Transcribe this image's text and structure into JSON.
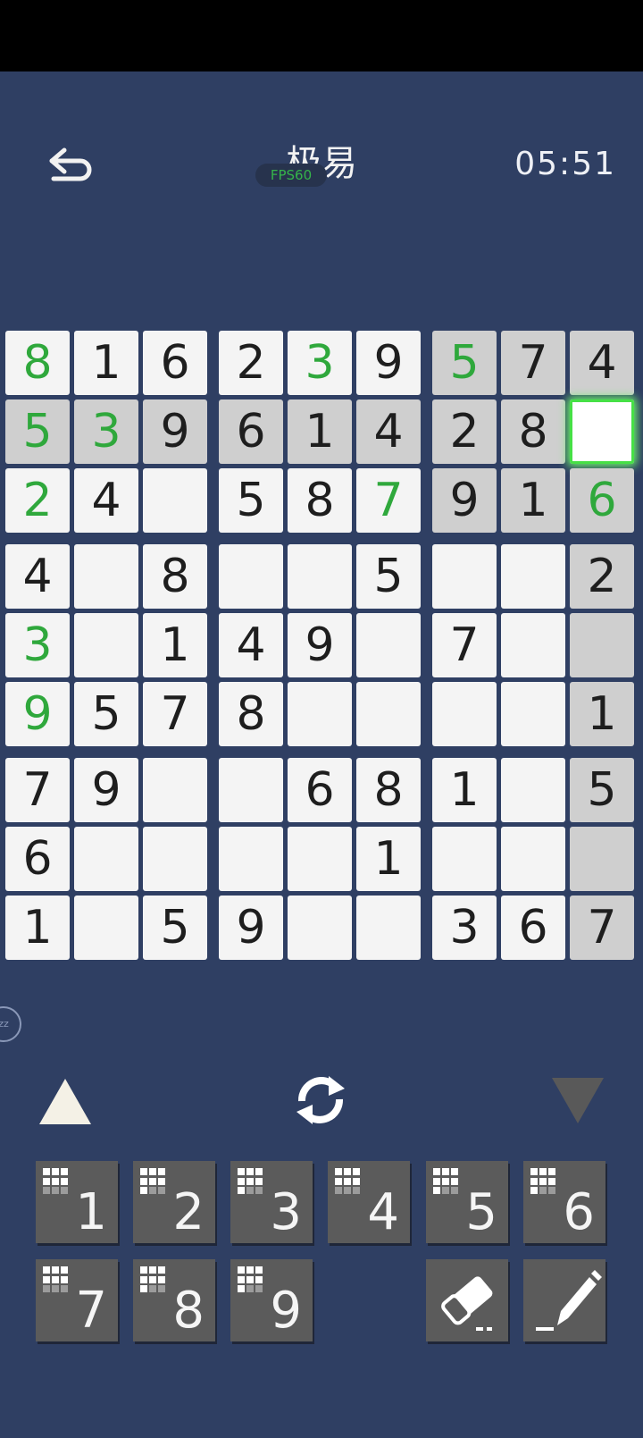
{
  "header": {
    "back_icon": "back-arrow-icon",
    "title": "极易",
    "fps_badge": "FPS60",
    "timer": "05:51"
  },
  "board": {
    "rows": [
      [
        "8",
        "1",
        "6",
        "2",
        "3",
        "9",
        "5",
        "7",
        "4"
      ],
      [
        "5",
        "3",
        "9",
        "6",
        "1",
        "4",
        "2",
        "8",
        ""
      ],
      [
        "2",
        "4",
        "",
        "5",
        "8",
        "7",
        "9",
        "1",
        "6"
      ],
      [
        "4",
        "",
        "8",
        "",
        "",
        "5",
        "",
        "",
        "2"
      ],
      [
        "3",
        "",
        "1",
        "4",
        "9",
        "",
        "7",
        "",
        ""
      ],
      [
        "9",
        "5",
        "7",
        "8",
        "",
        "",
        "",
        "",
        "1"
      ],
      [
        "7",
        "9",
        "",
        "",
        "6",
        "8",
        "1",
        "",
        "5"
      ],
      [
        "6",
        "",
        "",
        "",
        "",
        "1",
        "",
        "",
        ""
      ],
      [
        "1",
        "",
        "5",
        "9",
        "",
        "",
        "3",
        "6",
        "7"
      ]
    ],
    "given_green": [
      [
        0,
        0
      ],
      [
        0,
        4
      ],
      [
        0,
        6
      ],
      [
        1,
        0
      ],
      [
        1,
        1
      ],
      [
        2,
        0
      ],
      [
        2,
        5
      ],
      [
        2,
        8
      ],
      [
        4,
        0
      ],
      [
        5,
        0
      ]
    ],
    "selected_cell": [
      1,
      8
    ],
    "highlight_row": 1,
    "highlight_col": 8,
    "highlight_box": [
      0,
      2
    ],
    "colors": {
      "cell": "#f4f4f4",
      "highlight": "#cfcfcf",
      "green": "#2fa83c",
      "selected_glow": "#46e046",
      "background": "#2f3f63"
    }
  },
  "controls": {
    "up_icon": "triangle-up-icon",
    "rotate_icon": "rotate-refresh-icon",
    "down_icon": "triangle-down-icon"
  },
  "keypad": {
    "numbers": [
      "1",
      "2",
      "3",
      "4",
      "5",
      "6",
      "7",
      "8",
      "9"
    ],
    "eraser_icon": "eraser-icon",
    "pencil_icon": "pencil-icon"
  }
}
